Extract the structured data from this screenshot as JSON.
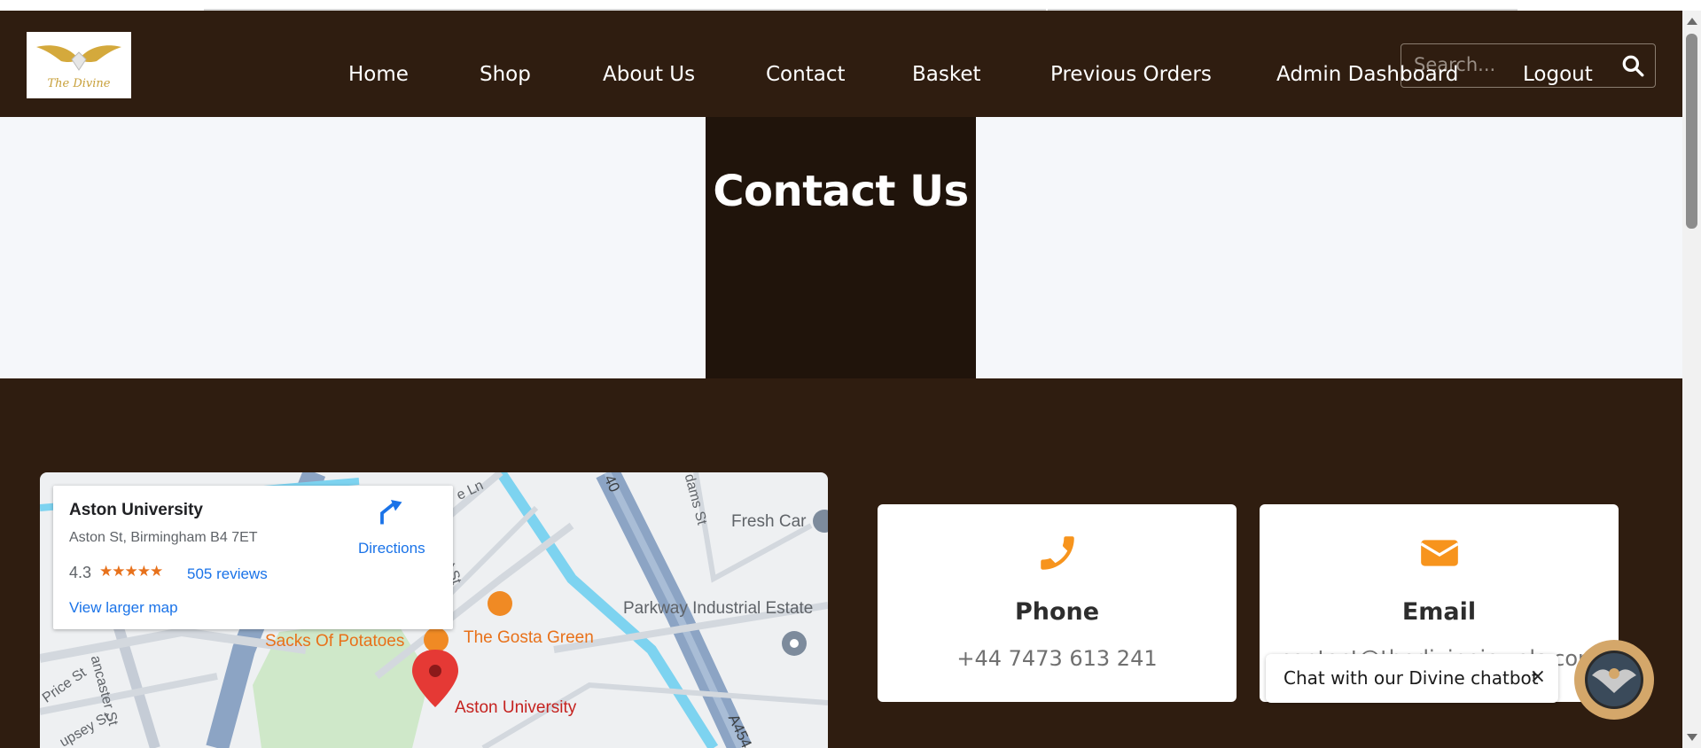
{
  "logo": {
    "text": "The Divine"
  },
  "nav": {
    "home": "Home",
    "shop": "Shop",
    "about": "About Us",
    "contact": "Contact",
    "basket": "Basket",
    "orders": "Previous Orders",
    "admin": "Admin Dashboard",
    "logout": "Logout"
  },
  "search": {
    "placeholder": "Search..."
  },
  "hero": {
    "title": "Contact Us"
  },
  "map": {
    "place_name": "Aston University",
    "address": "Aston St, Birmingham B4 7ET",
    "rating": "4.3",
    "stars": "★★★★★",
    "reviews": "505 reviews",
    "directions": "Directions",
    "larger_map": "View larger map",
    "labels": {
      "fresh": "Fresh Car",
      "parkway": "Parkway Industrial Estate",
      "sacks": "Sacks Of Potatoes",
      "gosta": "The Gosta Green",
      "aston": "Aston University",
      "price": "Price St",
      "lancaster": "ancaster St",
      "lupsey": "upsey St",
      "adams": "dams St",
      "a540": "40",
      "a454": "A454",
      "ln": "e Ln",
      "st": "t St"
    }
  },
  "contact_cards": {
    "phone_title": "Phone",
    "phone_value": "+44 7473 613 241",
    "email_title": "Email",
    "email_value": "contact@thedivinejewels.com"
  },
  "chatbot": {
    "text": "Chat with our Divine chatbot",
    "close": "×"
  },
  "colors": {
    "brand_brown": "#2f1d10",
    "hero_box": "#20140b",
    "accent_orange": "#f7941d"
  }
}
